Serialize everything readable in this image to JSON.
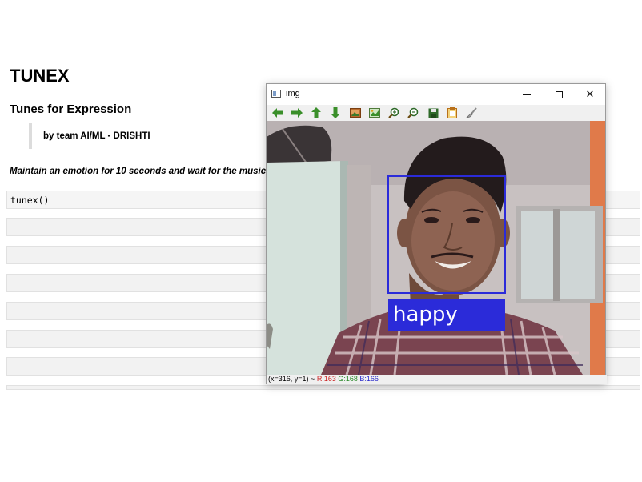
{
  "notebook": {
    "title": "TUNEX",
    "subtitle": "Tunes for Expression",
    "byline": "by team AI/ML - DRISHTI",
    "instruction": "Maintain an emotion for 10 seconds and wait for the music",
    "code_cell": "tunex()"
  },
  "window": {
    "title": "img",
    "controls": {
      "minimize": "minimize-icon",
      "maximize": "maximize-icon",
      "close": "✕"
    },
    "toolbar": [
      "arrow-left-icon",
      "arrow-right-icon",
      "arrow-up-icon",
      "arrow-down-icon",
      "image-icon",
      "picture-icon",
      "zoom-in-icon",
      "zoom-out-icon",
      "save-icon",
      "copy-icon",
      "brush-icon"
    ],
    "detection_label": "happy",
    "status": {
      "coords": "(x=316, y=1) ~",
      "r": "R:163",
      "g": "G:168",
      "b": "B:166"
    }
  },
  "colors": {
    "bbox": "#2b2bd9",
    "label_bg": "#2b2bd9",
    "label_text": "#ffffff",
    "arrow_green": "#3a8f2a"
  }
}
